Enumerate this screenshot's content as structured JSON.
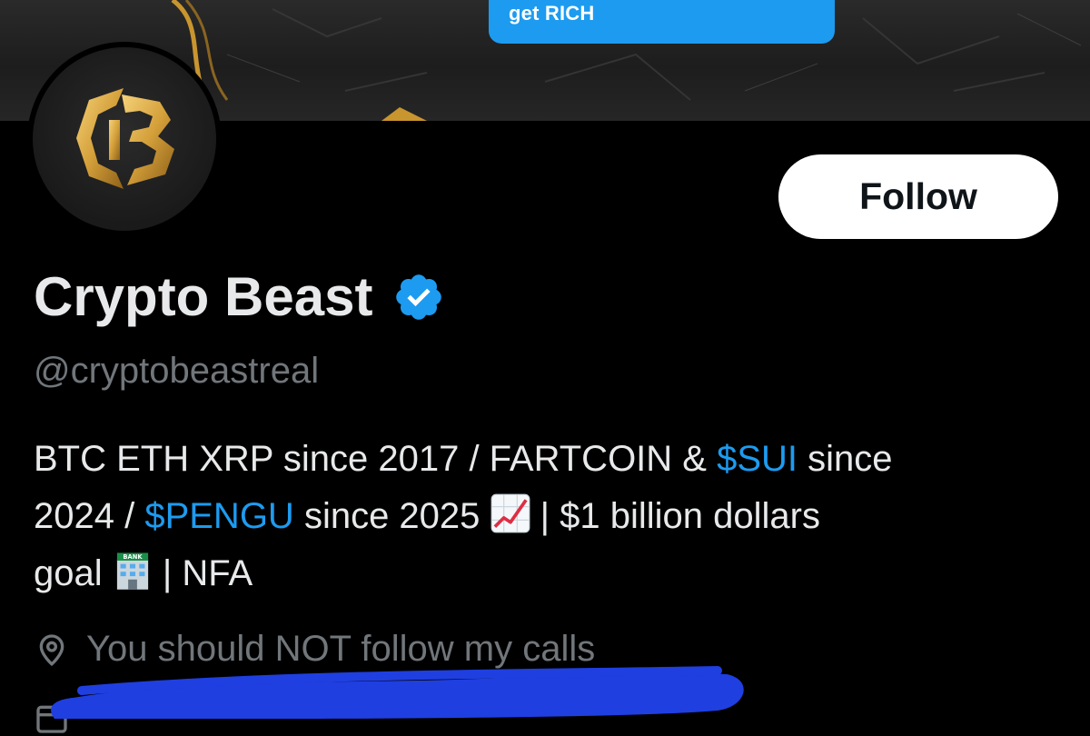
{
  "banner": {
    "speech_bubble_text": "get RICH"
  },
  "profile": {
    "display_name": "Crypto Beast",
    "handle": "@cryptobeastreal",
    "verified": true,
    "avatar_icon": "cb-monogram-logo",
    "follow_label": "Follow",
    "bio": {
      "line1": {
        "t1": "BTC ETH XRP since 2017 / FARTCOIN & ",
        "tag1": "$SUI",
        "t2": " since"
      },
      "line2": {
        "t1": "2024 / ",
        "tag1": "$PENGU",
        "t2": " since 2025 ",
        "emoji": "chart-increasing-icon",
        "t3": " | $1 billion dollars"
      },
      "line3": {
        "t1": "goal ",
        "emoji": "bank-icon",
        "t2": " | NFA"
      }
    },
    "location": "You should NOT follow my calls",
    "location_icon": "location-pin-icon"
  },
  "colors": {
    "background": "#000000",
    "accent": "#1d9bf0",
    "text_primary": "#e7e9ea",
    "text_secondary": "#71767b",
    "gold": "#d4a03a",
    "redaction": "#1f3fe0"
  }
}
